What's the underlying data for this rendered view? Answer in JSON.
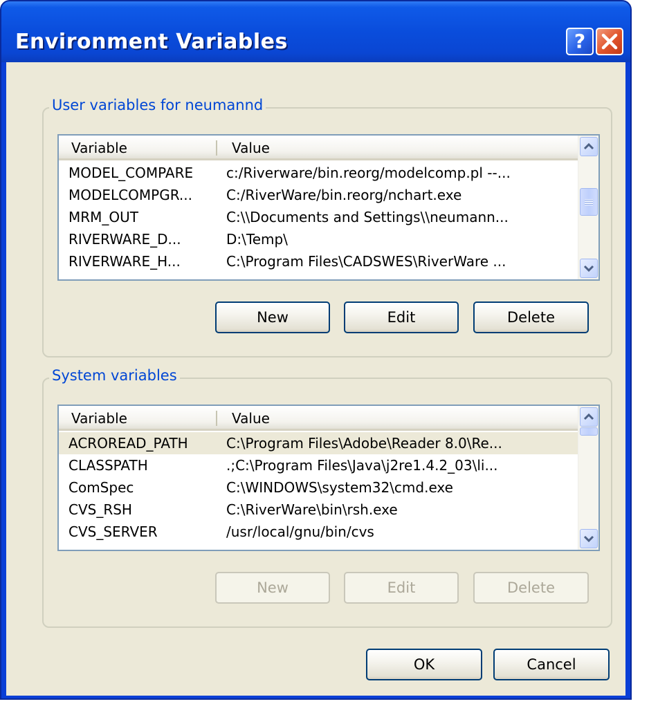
{
  "window": {
    "title": "Environment Variables",
    "help_label": "?"
  },
  "user_group": {
    "legend": "User variables for neumannd",
    "columns": [
      "Variable",
      "Value"
    ],
    "rows": [
      {
        "variable": "MODEL_COMPARE",
        "value": "c:/Riverware/bin.reorg/modelcomp.pl --..."
      },
      {
        "variable": "MODELCOMPGR...",
        "value": "C:/RiverWare/bin.reorg/nchart.exe"
      },
      {
        "variable": "MRM_OUT",
        "value": "C:\\\\Documents and Settings\\\\neumann..."
      },
      {
        "variable": "RIVERWARE_D...",
        "value": "D:\\Temp\\"
      },
      {
        "variable": "RIVERWARE_H...",
        "value": "C:\\Program Files\\CADSWES\\RiverWare ..."
      }
    ],
    "new_label": "New",
    "edit_label": "Edit",
    "delete_label": "Delete"
  },
  "system_group": {
    "legend": "System variables",
    "columns": [
      "Variable",
      "Value"
    ],
    "rows": [
      {
        "variable": "ACROREAD_PATH",
        "value": "C:\\Program Files\\Adobe\\Reader 8.0\\Re..."
      },
      {
        "variable": "CLASSPATH",
        "value": ".;C:\\Program Files\\Java\\j2re1.4.2_03\\li..."
      },
      {
        "variable": "ComSpec",
        "value": "C:\\WINDOWS\\system32\\cmd.exe"
      },
      {
        "variable": "CVS_RSH",
        "value": "C:\\RiverWare\\bin\\rsh.exe"
      },
      {
        "variable": "CVS_SERVER",
        "value": "/usr/local/gnu/bin/cvs"
      }
    ],
    "new_label": "New",
    "edit_label": "Edit",
    "delete_label": "Delete"
  },
  "footer": {
    "ok_label": "OK",
    "cancel_label": "Cancel"
  },
  "colors": {
    "title_bar": "#0a4ddc",
    "dialog_face": "#ece9d8",
    "group_legend": "#0046d5",
    "close_button": "#e0532b"
  }
}
